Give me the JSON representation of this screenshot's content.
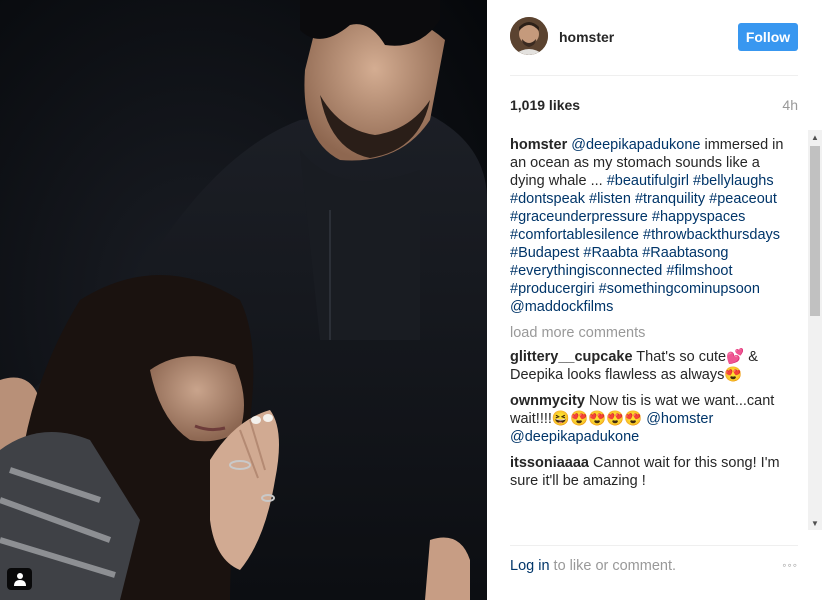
{
  "post": {
    "username": "homster",
    "follow_label": "Follow",
    "likes": "1,019 likes",
    "time": "4h"
  },
  "caption": {
    "author": "homster",
    "text_parts": [
      {
        "t": "@deepikapadukone",
        "link": true
      },
      {
        "t": " immersed in an ocean as my stomach sounds like a dying whale ... ",
        "link": false
      },
      {
        "t": "#beautifulgirl",
        "link": true
      },
      {
        "t": " ",
        "link": false
      },
      {
        "t": "#bellylaughs",
        "link": true
      },
      {
        "t": " ",
        "link": false
      },
      {
        "t": "#dontspeak",
        "link": true
      },
      {
        "t": " ",
        "link": false
      },
      {
        "t": "#listen",
        "link": true
      },
      {
        "t": " ",
        "link": false
      },
      {
        "t": "#tranquility",
        "link": true
      },
      {
        "t": " ",
        "link": false
      },
      {
        "t": "#peaceout",
        "link": true
      },
      {
        "t": " ",
        "link": false
      },
      {
        "t": "#graceunderpressure",
        "link": true
      },
      {
        "t": " ",
        "link": false
      },
      {
        "t": "#happyspaces",
        "link": true
      },
      {
        "t": " ",
        "link": false
      },
      {
        "t": "#comfortablesilence",
        "link": true
      },
      {
        "t": " ",
        "link": false
      },
      {
        "t": "#throwbackthursdays",
        "link": true
      },
      {
        "t": " ",
        "link": false
      },
      {
        "t": "#Budapest",
        "link": true
      },
      {
        "t": " ",
        "link": false
      },
      {
        "t": "#Raabta",
        "link": true
      },
      {
        "t": " ",
        "link": false
      },
      {
        "t": "#Raabtasong",
        "link": true
      },
      {
        "t": " ",
        "link": false
      },
      {
        "t": "#everythingisconnected",
        "link": true
      },
      {
        "t": " ",
        "link": false
      },
      {
        "t": "#filmshoot",
        "link": true
      },
      {
        "t": " ",
        "link": false
      },
      {
        "t": "#producergiri",
        "link": true
      },
      {
        "t": " ",
        "link": false
      },
      {
        "t": "#somethingcominupsoon",
        "link": true
      },
      {
        "t": " ",
        "link": false
      },
      {
        "t": "@maddockfilms",
        "link": true
      }
    ]
  },
  "load_more": "load more comments",
  "comments": [
    {
      "author": "glittery__cupcake",
      "parts": [
        {
          "t": "That's so cute💕 & Deepika looks flawless as always😍",
          "link": false
        }
      ]
    },
    {
      "author": "ownmycity",
      "parts": [
        {
          "t": "Now tis is wat we want...cant wait!!!!😆😍😍😍😍 ",
          "link": false
        },
        {
          "t": "@homster",
          "link": true
        },
        {
          "t": " ",
          "link": false
        },
        {
          "t": "@deepikapadukone",
          "link": true
        }
      ]
    },
    {
      "author": "itssoniaaaa",
      "parts": [
        {
          "t": "Cannot wait for this song! I'm sure it'll be amazing !",
          "link": false
        }
      ]
    }
  ],
  "footer": {
    "login_link": "Log in",
    "login_rest": " to like or comment.",
    "more_icon": "◦◦◦"
  },
  "colors": {
    "accent": "#3897f0",
    "link": "#003569",
    "muted": "#999999"
  }
}
